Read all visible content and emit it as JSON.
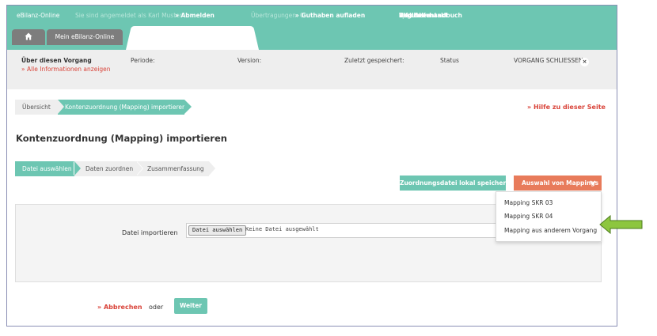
{
  "topbar": {
    "app_name": "eBilanz-Online",
    "login_text": "Sie sind angemeldet als Karl Muster",
    "logout": "» Abmelden",
    "transfers": "Übertragungen: 0",
    "credit": "» Guthaben aufladen",
    "links": [
      "Benutzerhandbuch",
      "Forum",
      "Webinare",
      "Info & Kontakt",
      "English"
    ]
  },
  "tabs": {
    "home_icon": "home-icon",
    "main_label": "Mein eBilanz-Online"
  },
  "infobar": {
    "about": "Über diesen Vorgang",
    "all_info": "» Alle Informationen anzeigen",
    "period": "Periode:",
    "version": "Version:",
    "last_saved": "Zuletzt gespeichert:",
    "status": "Status",
    "close_process": "VORGANG SCHLIESSEN",
    "close_icon": "×"
  },
  "breadcrumb": {
    "items": [
      "Übersicht",
      "Kontenzuordnung (Mapping) importieren"
    ]
  },
  "help_link": "» Hilfe zu dieser Seite",
  "page_title": "Kontenzuordnung (Mapping) importieren",
  "steps": [
    "Datei auswählen",
    "Daten zuordnen",
    "Zusammenfassung"
  ],
  "buttons": {
    "save_local": "Zuordnungsdatei lokal speichern",
    "mapping_select": "Auswahl von Mappings"
  },
  "dropdown": {
    "items": [
      "Mapping SKR 03",
      "Mapping SKR 04",
      "Mapping aus anderem Vorgang"
    ]
  },
  "import": {
    "label": "Datei importieren",
    "file_button": "Datei auswählen",
    "file_status": "Keine Datei ausgewählt"
  },
  "footer": {
    "cancel": "» Abbrechen",
    "or": "oder",
    "next": "Weiter"
  },
  "colors": {
    "accent": "#6dc6b2",
    "orange": "#e87b5b",
    "link_red": "#d9443a",
    "annotation_arrow": "#8dc63f"
  }
}
